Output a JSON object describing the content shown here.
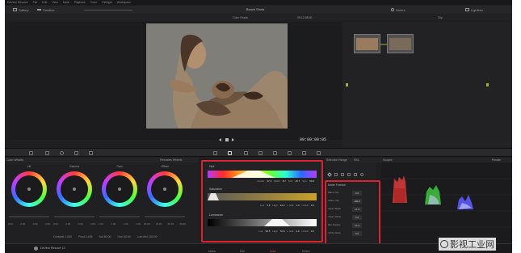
{
  "app": {
    "menu": [
      "DaVinci Resolve",
      "File",
      "Edit",
      "View",
      "Mark",
      "Playback",
      "Color",
      "Fairlight",
      "Workspace"
    ],
    "footer_name": "DaVinci Resolve 12"
  },
  "toolbar": {
    "gallery": "Gallery",
    "timeline": "Timeline",
    "title": "Beach Shots",
    "nodes": "Nodes",
    "lightbox": "Lightbox"
  },
  "viewer": {
    "mode": "Color Grade",
    "timecode_top": "05:12:58:00",
    "clip_label": "Clip",
    "timecode": "00:00:09:05"
  },
  "panels": {
    "color_wheels": "Color Wheels",
    "primaries": "Primaries Wheels",
    "qualifier": "HSL",
    "selection_range": "Selection Range",
    "matte_finesse": "Matte Finesse",
    "scopes": "Scopes",
    "parade": "Parade"
  },
  "wheels": [
    {
      "label": "Lift",
      "values": [
        "0.00",
        "0.00",
        "0.00",
        "0.00"
      ]
    },
    {
      "label": "Gamma",
      "values": [
        "0.00",
        "0.00",
        "0.00",
        "0.00"
      ]
    },
    {
      "label": "Gain",
      "values": [
        "1.00",
        "1.00",
        "1.00",
        "1.00"
      ]
    },
    {
      "label": "Offset",
      "values": [
        "25.00",
        "25.00",
        "25.00",
        "25.00"
      ]
    }
  ],
  "wheel_footer": {
    "contrast": "Contrast 1.000",
    "pivot": "Pivot 0.435",
    "sat": "Sat 50.00",
    "hue": "Hue 50.00",
    "lummix": "Lum Mix 100.00"
  },
  "hsl": {
    "hue": {
      "title": "Hue",
      "center_label": "Center",
      "center": "37.4",
      "width_label": "Width",
      "width": "8.7",
      "soft_label": "Soft",
      "soft": "15.7",
      "sym_label": "Sym",
      "sym": "50.0"
    },
    "saturation": {
      "title": "Saturation",
      "low_label": "Low",
      "low": "5.6",
      "high_label": "High",
      "high": "14.2",
      "lsoft_label": "L.Soft",
      "lsoft": "1.0",
      "hsoft_label": "H.Soft",
      "hsoft": "3.0"
    },
    "luminance": {
      "title": "Luminance",
      "low_label": "Low",
      "low": "62.5",
      "high_label": "High",
      "high": "72.6",
      "lsoft_label": "L.Soft",
      "lsoft": "2.9",
      "hsoft_label": "H.Soft",
      "hsoft": "3.0"
    }
  },
  "matte": [
    {
      "label": "Black Clip",
      "value": "0.0"
    },
    {
      "label": "White Clip",
      "value": "100.0"
    },
    {
      "label": "Clean Black",
      "value": "17.2"
    },
    {
      "label": "Clean White",
      "value": "0.0"
    },
    {
      "label": "Blur Radius",
      "value": "17.2"
    },
    {
      "label": "In/Out Ratio",
      "value": "0.0"
    }
  ],
  "pages": [
    "Media",
    "Edit",
    "Color",
    "Deliver"
  ],
  "watermark": "影视工业网"
}
